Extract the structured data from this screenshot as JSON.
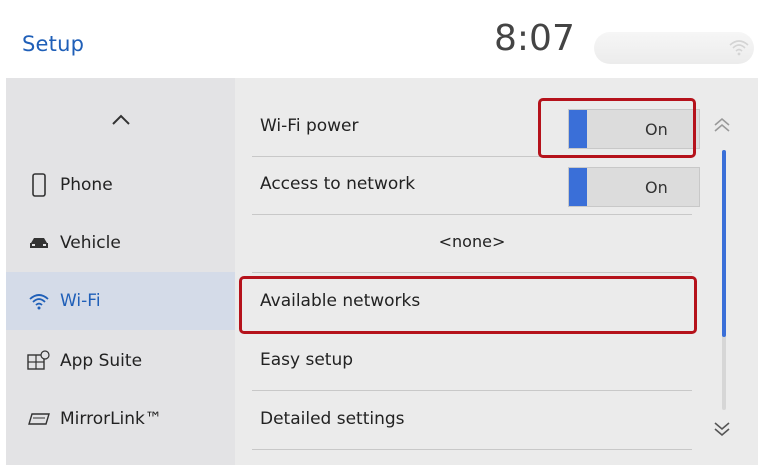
{
  "header": {
    "title": "Setup",
    "time": "8:07",
    "status_icon": "wifi-icon"
  },
  "sidebar": {
    "scroll_up_icon": "chevron-up-icon",
    "items": [
      {
        "label": "Phone",
        "icon": "phone-icon"
      },
      {
        "label": "Vehicle",
        "icon": "car-icon"
      },
      {
        "label": "Wi-Fi",
        "icon": "wifi-icon",
        "active": true
      },
      {
        "label": "App Suite",
        "icon": "app-suite-icon"
      },
      {
        "label": "MirrorLink™",
        "icon": "mirrorlink-icon"
      }
    ]
  },
  "content": {
    "rows": [
      {
        "label": "Wi-Fi power",
        "toggle": "On"
      },
      {
        "label": "Access to network",
        "toggle": "On"
      },
      {
        "label": "<none>"
      },
      {
        "label": "Available networks"
      },
      {
        "label": "Easy setup"
      },
      {
        "label": "Detailed settings"
      }
    ]
  },
  "scrollbar": {
    "up_icon": "double-chevron-up-icon",
    "down_icon": "double-chevron-down-icon",
    "position_fraction": 0.0,
    "visible_fraction": 0.72
  },
  "colors": {
    "accent": "#1f5fb8",
    "toggle_on": "#3a6fd8",
    "highlight": "#b5121b",
    "active_item_bg": "#d4dbe8"
  }
}
